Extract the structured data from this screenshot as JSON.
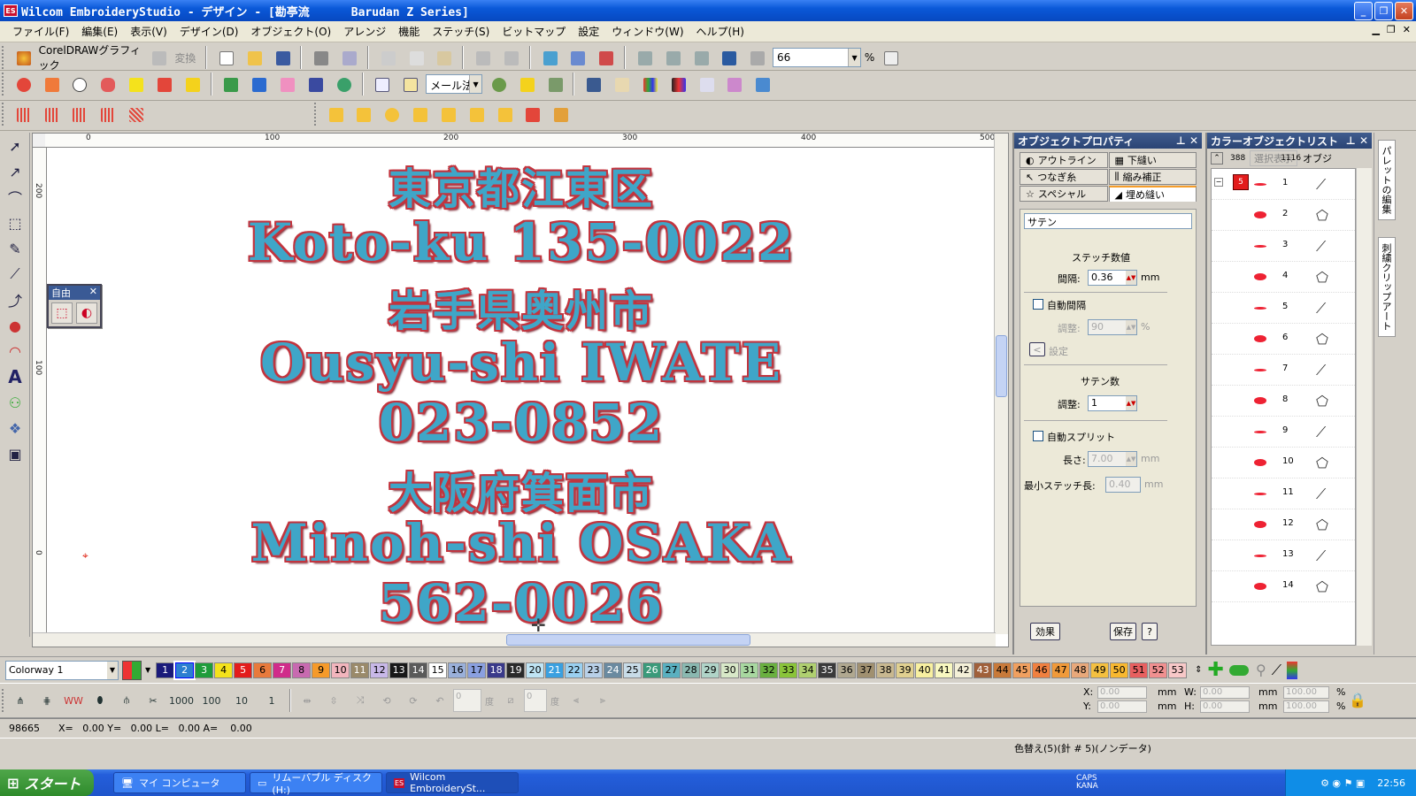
{
  "titlebar": {
    "icon": "ES",
    "title": "Wilcom EmbroideryStudio - デザイン - [勘亭流      Barudan Z Series]"
  },
  "menu": [
    "ファイル(F)",
    "編集(E)",
    "表示(V)",
    "デザイン(D)",
    "オブジェクト(O)",
    "アレンジ",
    "機能",
    "ステッチ(S)",
    "ビットマップ",
    "設定",
    "ウィンドウ(W)",
    "ヘルプ(H)"
  ],
  "toolbar": {
    "corel_label": "CorelDRAWグラフィック",
    "convert_label": "変換",
    "zoom_value": "66",
    "zoom_unit": "%",
    "method_value": "メール法"
  },
  "ruler": {
    "h_ticks": [
      "0",
      "100",
      "200",
      "300",
      "400",
      "500"
    ],
    "v_ticks": [
      "200",
      "100",
      "0"
    ]
  },
  "design_lines": [
    {
      "text": "東京都江東区",
      "kind": "jp"
    },
    {
      "text": "Koto-ku 135-0022",
      "kind": "en"
    },
    {
      "text": "岩手県奥州市",
      "kind": "jp"
    },
    {
      "text": "Ousyu-shi IWATE",
      "kind": "en"
    },
    {
      "text": "023-0852",
      "kind": "en"
    },
    {
      "text": "大阪府箕面市",
      "kind": "jp"
    },
    {
      "text": "Minoh-shi OSAKA",
      "kind": "en"
    },
    {
      "text": "562-0026",
      "kind": "en"
    }
  ],
  "freebox": {
    "title": "自由"
  },
  "objprops": {
    "title": "オブジェクトプロパティ",
    "tabs": [
      "アウトライン",
      "下縫い",
      "つなぎ糸",
      "縮み補正",
      "スペシャル",
      "埋め縫い"
    ],
    "stitch_type": "サテン",
    "section_density": "ステッチ数値",
    "spacing_label": "間隔:",
    "spacing_value": "0.36",
    "unit_mm": "mm",
    "auto_spacing": "自動間隔",
    "adjust_label": "調整:",
    "adjust_value": "90",
    "unit_pct": "%",
    "set_label": "設定",
    "section_satin": "サテン数",
    "satin_adjust_label": "調整:",
    "satin_adjust_value": "1",
    "auto_split": "自動スプリット",
    "length_label": "長さ:",
    "length_value": "7.00",
    "min_stitch_label": "最小ステッチ長:",
    "min_stitch_value": "0.40",
    "effect_btn": "効果",
    "save_btn": "保存",
    "help_btn": "?"
  },
  "colorlist": {
    "title": "カラーオブジェクトリスト",
    "filter_btn": "選択表示",
    "tab_label": "オブジ",
    "col1": "388",
    "col2": "1116",
    "swatch_label": "5",
    "rows": [
      "1",
      "2",
      "3",
      "4",
      "5",
      "6",
      "7",
      "8",
      "9",
      "10",
      "11",
      "12",
      "13",
      "14"
    ]
  },
  "rightstrip": [
    "パレットの編集",
    "刺繍クリップアート"
  ],
  "palette": {
    "colorway": "Colorway 1",
    "swatches": [
      {
        "n": "1",
        "c": "#1a1a7a"
      },
      {
        "n": "2",
        "c": "#2c7fd0"
      },
      {
        "n": "3",
        "c": "#1e9c3a"
      },
      {
        "n": "4",
        "c": "#f4e21c"
      },
      {
        "n": "5",
        "c": "#e31c1c"
      },
      {
        "n": "6",
        "c": "#e87a3c"
      },
      {
        "n": "7",
        "c": "#d02c8a"
      },
      {
        "n": "8",
        "c": "#c86ab0"
      },
      {
        "n": "9",
        "c": "#f59a2a"
      },
      {
        "n": "10",
        "c": "#f2b5bd"
      },
      {
        "n": "11",
        "c": "#9a8a6a"
      },
      {
        "n": "12",
        "c": "#c8b8e8"
      },
      {
        "n": "13",
        "c": "#181818"
      },
      {
        "n": "14",
        "c": "#5a5a5a"
      },
      {
        "n": "15",
        "c": "#ffffff"
      },
      {
        "n": "16",
        "c": "#9ab0da"
      },
      {
        "n": "17",
        "c": "#8aa0e0"
      },
      {
        "n": "18",
        "c": "#3a3a8a"
      },
      {
        "n": "19",
        "c": "#2a2a2a"
      },
      {
        "n": "20",
        "c": "#bfe4f4"
      },
      {
        "n": "21",
        "c": "#3aa0e0"
      },
      {
        "n": "22",
        "c": "#9ad0f0"
      },
      {
        "n": "23",
        "c": "#b8d0e8"
      },
      {
        "n": "24",
        "c": "#6a8aa0"
      },
      {
        "n": "25",
        "c": "#c8dce8"
      },
      {
        "n": "26",
        "c": "#3a9a7a"
      },
      {
        "n": "27",
        "c": "#5ab0c0"
      },
      {
        "n": "28",
        "c": "#8ab8b0"
      },
      {
        "n": "29",
        "c": "#b0d4c8"
      },
      {
        "n": "30",
        "c": "#d8e8c8"
      },
      {
        "n": "31",
        "c": "#a8d8a0"
      },
      {
        "n": "32",
        "c": "#6ab040"
      },
      {
        "n": "33",
        "c": "#8ac43a"
      },
      {
        "n": "34",
        "c": "#b0d070"
      },
      {
        "n": "35",
        "c": "#3a3a3a"
      },
      {
        "n": "36",
        "c": "#b0a890"
      },
      {
        "n": "37",
        "c": "#a09070"
      },
      {
        "n": "38",
        "c": "#c8b890"
      },
      {
        "n": "39",
        "c": "#e0d090"
      },
      {
        "n": "40",
        "c": "#f8f0a0"
      },
      {
        "n": "41",
        "c": "#f8f8c0"
      },
      {
        "n": "42",
        "c": "#f4f0d8"
      },
      {
        "n": "43",
        "c": "#a0603a"
      },
      {
        "n": "44",
        "c": "#c87a3a"
      },
      {
        "n": "45",
        "c": "#f0a060"
      },
      {
        "n": "46",
        "c": "#f08040"
      },
      {
        "n": "47",
        "c": "#f09a3a"
      },
      {
        "n": "48",
        "c": "#e8a87a"
      },
      {
        "n": "49",
        "c": "#f4c040"
      },
      {
        "n": "50",
        "c": "#f8b830"
      },
      {
        "n": "51",
        "c": "#e86060"
      },
      {
        "n": "52",
        "c": "#f09090"
      },
      {
        "n": "53",
        "c": "#f8c8c8"
      }
    ]
  },
  "stitch_presets": [
    "1000",
    "100",
    "10",
    "1"
  ],
  "stitch_fields": {
    "angle_value": "0",
    "angle_unit": "度",
    "rot_value": "0",
    "rot_unit": "度"
  },
  "coords": {
    "x_label": "X:",
    "y_label": "Y:",
    "w_label": "W:",
    "h_label": "H:",
    "x": "0.00",
    "y": "0.00",
    "w": "0.00",
    "h": "0.00",
    "wp": "100.00",
    "hp": "100.00",
    "unit": "mm",
    "pct": "%"
  },
  "status": {
    "count": "98665",
    "pos": "X=   0.00 Y=   0.00 L=   0.00 A=    0.00",
    "info": "色替え(5)(針 # 5)(ノンデータ)"
  },
  "taskbar": {
    "start": "スタート",
    "tasks": [
      "マイ コンピュータ",
      "リムーバブル ディスク (H:)",
      "Wilcom EmbroiderySt..."
    ],
    "caps": "CAPS",
    "kana": "KANA",
    "time": "22:56"
  }
}
